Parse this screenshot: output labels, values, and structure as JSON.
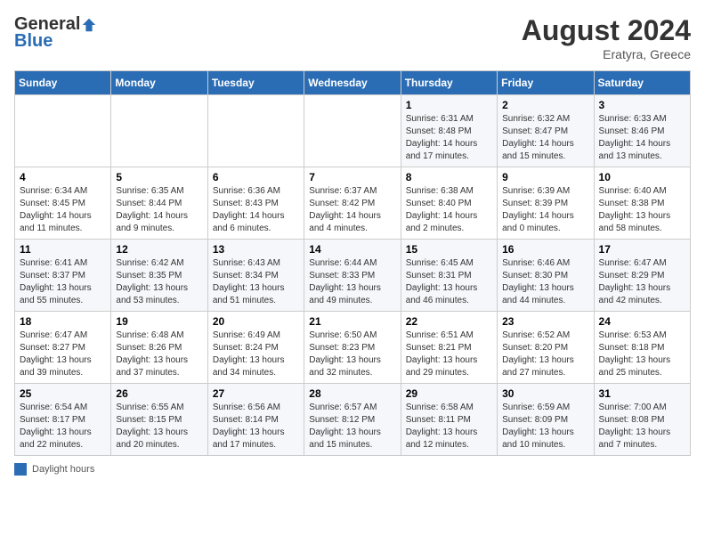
{
  "header": {
    "logo_general": "General",
    "logo_blue": "Blue",
    "month_year": "August 2024",
    "location": "Eratyra, Greece"
  },
  "days_of_week": [
    "Sunday",
    "Monday",
    "Tuesday",
    "Wednesday",
    "Thursday",
    "Friday",
    "Saturday"
  ],
  "weeks": [
    [
      {
        "day": "",
        "sunrise": "",
        "sunset": "",
        "daylight": ""
      },
      {
        "day": "",
        "sunrise": "",
        "sunset": "",
        "daylight": ""
      },
      {
        "day": "",
        "sunrise": "",
        "sunset": "",
        "daylight": ""
      },
      {
        "day": "",
        "sunrise": "",
        "sunset": "",
        "daylight": ""
      },
      {
        "day": "1",
        "sunrise": "Sunrise: 6:31 AM",
        "sunset": "Sunset: 8:48 PM",
        "daylight": "Daylight: 14 hours and 17 minutes."
      },
      {
        "day": "2",
        "sunrise": "Sunrise: 6:32 AM",
        "sunset": "Sunset: 8:47 PM",
        "daylight": "Daylight: 14 hours and 15 minutes."
      },
      {
        "day": "3",
        "sunrise": "Sunrise: 6:33 AM",
        "sunset": "Sunset: 8:46 PM",
        "daylight": "Daylight: 14 hours and 13 minutes."
      }
    ],
    [
      {
        "day": "4",
        "sunrise": "Sunrise: 6:34 AM",
        "sunset": "Sunset: 8:45 PM",
        "daylight": "Daylight: 14 hours and 11 minutes."
      },
      {
        "day": "5",
        "sunrise": "Sunrise: 6:35 AM",
        "sunset": "Sunset: 8:44 PM",
        "daylight": "Daylight: 14 hours and 9 minutes."
      },
      {
        "day": "6",
        "sunrise": "Sunrise: 6:36 AM",
        "sunset": "Sunset: 8:43 PM",
        "daylight": "Daylight: 14 hours and 6 minutes."
      },
      {
        "day": "7",
        "sunrise": "Sunrise: 6:37 AM",
        "sunset": "Sunset: 8:42 PM",
        "daylight": "Daylight: 14 hours and 4 minutes."
      },
      {
        "day": "8",
        "sunrise": "Sunrise: 6:38 AM",
        "sunset": "Sunset: 8:40 PM",
        "daylight": "Daylight: 14 hours and 2 minutes."
      },
      {
        "day": "9",
        "sunrise": "Sunrise: 6:39 AM",
        "sunset": "Sunset: 8:39 PM",
        "daylight": "Daylight: 14 hours and 0 minutes."
      },
      {
        "day": "10",
        "sunrise": "Sunrise: 6:40 AM",
        "sunset": "Sunset: 8:38 PM",
        "daylight": "Daylight: 13 hours and 58 minutes."
      }
    ],
    [
      {
        "day": "11",
        "sunrise": "Sunrise: 6:41 AM",
        "sunset": "Sunset: 8:37 PM",
        "daylight": "Daylight: 13 hours and 55 minutes."
      },
      {
        "day": "12",
        "sunrise": "Sunrise: 6:42 AM",
        "sunset": "Sunset: 8:35 PM",
        "daylight": "Daylight: 13 hours and 53 minutes."
      },
      {
        "day": "13",
        "sunrise": "Sunrise: 6:43 AM",
        "sunset": "Sunset: 8:34 PM",
        "daylight": "Daylight: 13 hours and 51 minutes."
      },
      {
        "day": "14",
        "sunrise": "Sunrise: 6:44 AM",
        "sunset": "Sunset: 8:33 PM",
        "daylight": "Daylight: 13 hours and 49 minutes."
      },
      {
        "day": "15",
        "sunrise": "Sunrise: 6:45 AM",
        "sunset": "Sunset: 8:31 PM",
        "daylight": "Daylight: 13 hours and 46 minutes."
      },
      {
        "day": "16",
        "sunrise": "Sunrise: 6:46 AM",
        "sunset": "Sunset: 8:30 PM",
        "daylight": "Daylight: 13 hours and 44 minutes."
      },
      {
        "day": "17",
        "sunrise": "Sunrise: 6:47 AM",
        "sunset": "Sunset: 8:29 PM",
        "daylight": "Daylight: 13 hours and 42 minutes."
      }
    ],
    [
      {
        "day": "18",
        "sunrise": "Sunrise: 6:47 AM",
        "sunset": "Sunset: 8:27 PM",
        "daylight": "Daylight: 13 hours and 39 minutes."
      },
      {
        "day": "19",
        "sunrise": "Sunrise: 6:48 AM",
        "sunset": "Sunset: 8:26 PM",
        "daylight": "Daylight: 13 hours and 37 minutes."
      },
      {
        "day": "20",
        "sunrise": "Sunrise: 6:49 AM",
        "sunset": "Sunset: 8:24 PM",
        "daylight": "Daylight: 13 hours and 34 minutes."
      },
      {
        "day": "21",
        "sunrise": "Sunrise: 6:50 AM",
        "sunset": "Sunset: 8:23 PM",
        "daylight": "Daylight: 13 hours and 32 minutes."
      },
      {
        "day": "22",
        "sunrise": "Sunrise: 6:51 AM",
        "sunset": "Sunset: 8:21 PM",
        "daylight": "Daylight: 13 hours and 29 minutes."
      },
      {
        "day": "23",
        "sunrise": "Sunrise: 6:52 AM",
        "sunset": "Sunset: 8:20 PM",
        "daylight": "Daylight: 13 hours and 27 minutes."
      },
      {
        "day": "24",
        "sunrise": "Sunrise: 6:53 AM",
        "sunset": "Sunset: 8:18 PM",
        "daylight": "Daylight: 13 hours and 25 minutes."
      }
    ],
    [
      {
        "day": "25",
        "sunrise": "Sunrise: 6:54 AM",
        "sunset": "Sunset: 8:17 PM",
        "daylight": "Daylight: 13 hours and 22 minutes."
      },
      {
        "day": "26",
        "sunrise": "Sunrise: 6:55 AM",
        "sunset": "Sunset: 8:15 PM",
        "daylight": "Daylight: 13 hours and 20 minutes."
      },
      {
        "day": "27",
        "sunrise": "Sunrise: 6:56 AM",
        "sunset": "Sunset: 8:14 PM",
        "daylight": "Daylight: 13 hours and 17 minutes."
      },
      {
        "day": "28",
        "sunrise": "Sunrise: 6:57 AM",
        "sunset": "Sunset: 8:12 PM",
        "daylight": "Daylight: 13 hours and 15 minutes."
      },
      {
        "day": "29",
        "sunrise": "Sunrise: 6:58 AM",
        "sunset": "Sunset: 8:11 PM",
        "daylight": "Daylight: 13 hours and 12 minutes."
      },
      {
        "day": "30",
        "sunrise": "Sunrise: 6:59 AM",
        "sunset": "Sunset: 8:09 PM",
        "daylight": "Daylight: 13 hours and 10 minutes."
      },
      {
        "day": "31",
        "sunrise": "Sunrise: 7:00 AM",
        "sunset": "Sunset: 8:08 PM",
        "daylight": "Daylight: 13 hours and 7 minutes."
      }
    ]
  ],
  "footer": {
    "daylight_label": "Daylight hours"
  }
}
